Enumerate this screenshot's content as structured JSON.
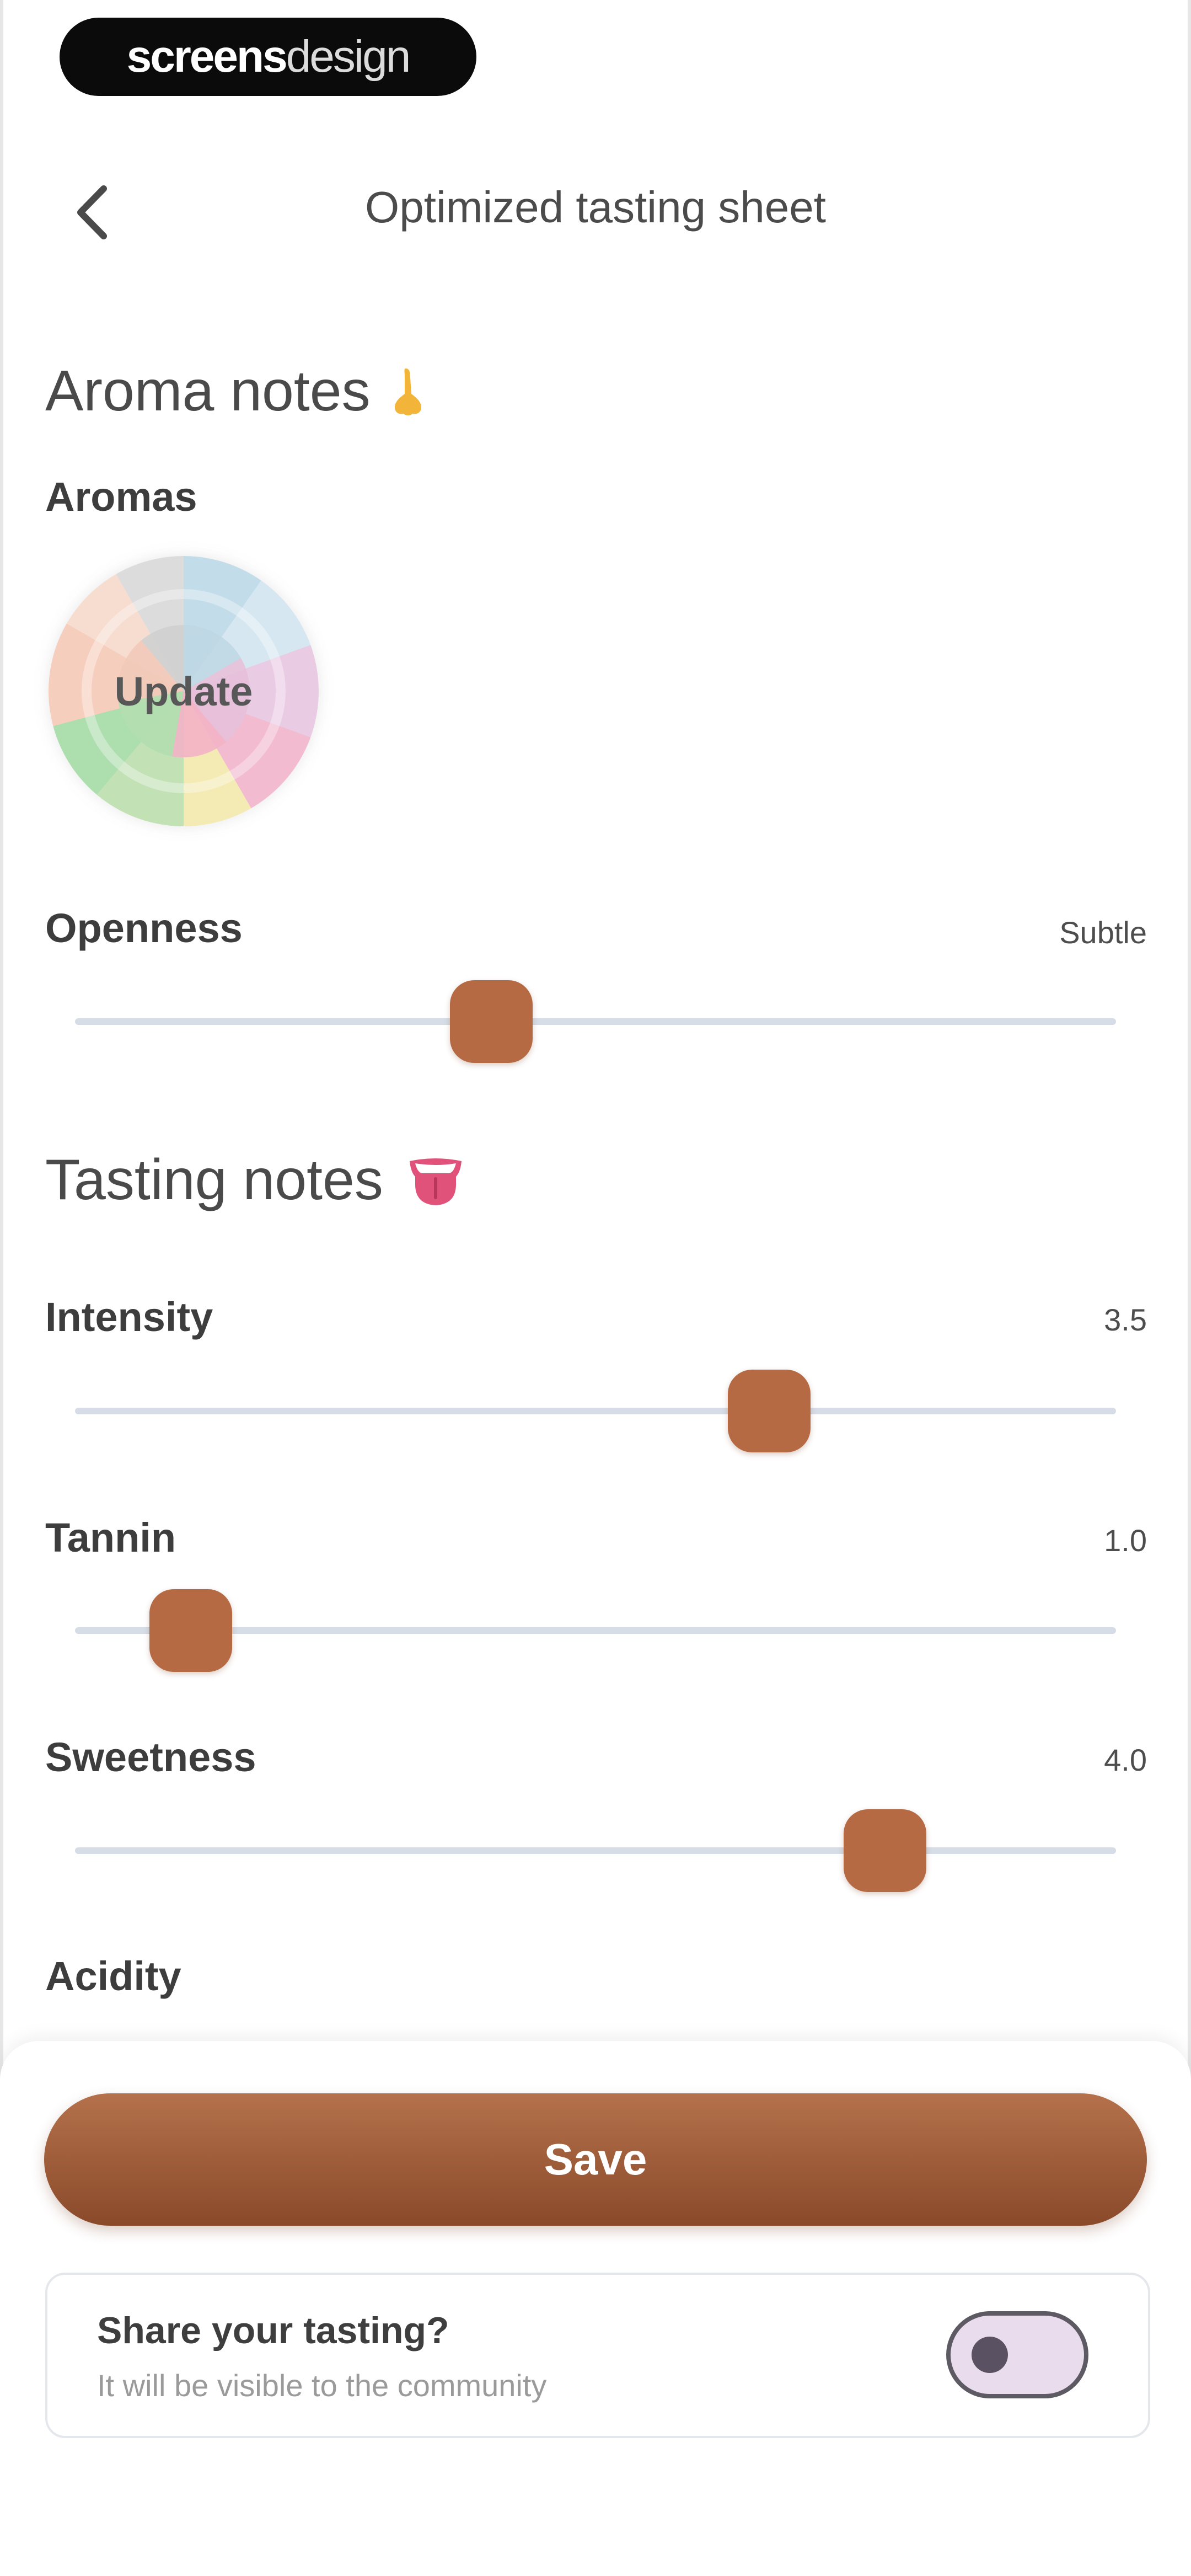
{
  "watermark": {
    "bold": "screens",
    "light": "design"
  },
  "header": {
    "title": "Optimized tasting sheet"
  },
  "aroma_section": {
    "title": "Aroma notes",
    "aromas_label": "Aromas",
    "wheel_button_label": "Update"
  },
  "openness": {
    "label": "Openness",
    "value": "Subtle",
    "level_fraction": 0.4
  },
  "tasting_section": {
    "title": "Tasting notes"
  },
  "sliders": {
    "intensity": {
      "label": "Intensity",
      "value": "3.5",
      "level_fraction": 0.667
    },
    "tannin": {
      "label": "Tannin",
      "value": "1.0",
      "level_fraction": 0.111
    },
    "sweetness": {
      "label": "Sweetness",
      "value": "4.0",
      "level_fraction": 0.778
    },
    "acidity": {
      "label": "Acidity"
    }
  },
  "actions": {
    "save_label": "Save",
    "share_title": "Share your tasting?",
    "share_subtitle": "It will be visible to the community",
    "share_toggle_on": false
  },
  "colors": {
    "accent": "#b56a44",
    "accent_dark": "#8a4a2a",
    "track": "#d6dde6"
  }
}
